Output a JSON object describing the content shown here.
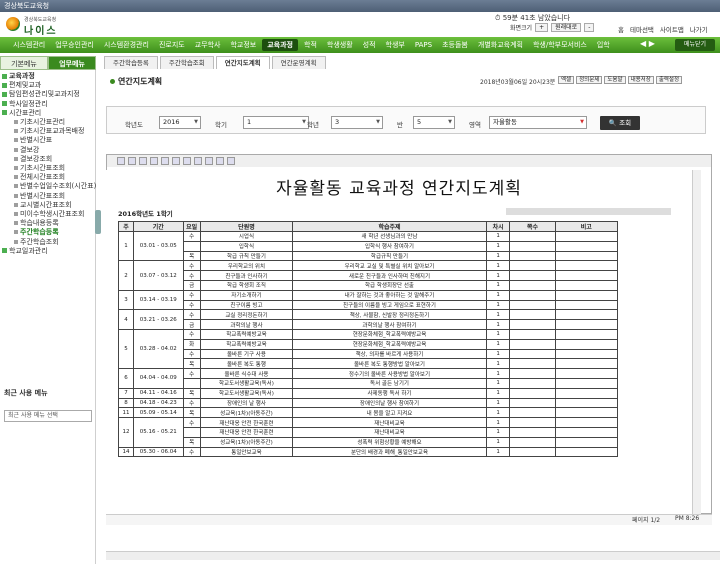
{
  "window": {
    "title": "경상북도교육청"
  },
  "logo": {
    "org": "경상북도교육청",
    "name": "나이스"
  },
  "session": {
    "text": "59분 41초 남았습니다",
    "zoom_label": "화면크기",
    "zoom_plus": "+",
    "zoom_value": "원래대로",
    "zoom_minus": "-"
  },
  "top_links": [
    "홈",
    "테마선택",
    "사이트맵",
    "나가기"
  ],
  "menu": [
    "시스템관리",
    "업무승인관리",
    "시스템환경관리",
    "진로지도",
    "교무학사",
    "학교정보",
    "교육과정",
    "학적",
    "학생생활",
    "성적",
    "학생부",
    "PAPS",
    "초등돌봄",
    "개별화교육계획",
    "학생/학부모서비스",
    "입학"
  ],
  "menu_active": 6,
  "close_all": "메뉴닫기",
  "left_tabs": [
    "기본메뉴",
    "업무메뉴"
  ],
  "tree": [
    {
      "label": "교육과정",
      "level": 0
    },
    {
      "label": "편제및교과",
      "level": 1
    },
    {
      "label": "탐임편성관리및교과지정",
      "level": 1
    },
    {
      "label": "학사일정관리",
      "level": 1
    },
    {
      "label": "시간표관리",
      "level": 1
    },
    {
      "label": "기초시간표관리",
      "level": 2
    },
    {
      "label": "기초시간표교과목배정",
      "level": 2
    },
    {
      "label": "반별시간표",
      "level": 2
    },
    {
      "label": "결보강",
      "level": 2
    },
    {
      "label": "결보강조회",
      "level": 2
    },
    {
      "label": "기초시간표조회",
      "level": 2
    },
    {
      "label": "전체시간표조회",
      "level": 2
    },
    {
      "label": "반별수업일수조회(시간표)",
      "level": 2
    },
    {
      "label": "반별시간표조회",
      "level": 2
    },
    {
      "label": "교시별시간표조회",
      "level": 2
    },
    {
      "label": "미이수학생시간표조회",
      "level": 2
    },
    {
      "label": "학습내용등록",
      "level": 2
    },
    {
      "label": "주간학습등록",
      "level": 2,
      "active": true
    },
    {
      "label": "주간학습조회",
      "level": 2
    },
    {
      "label": "학교일과관리",
      "level": 1
    }
  ],
  "recent": {
    "title": "최근 사용 메뉴",
    "placeholder": "최근 사용 메뉴 선택"
  },
  "page_tabs": [
    "주간학습등록",
    "주간학습조회",
    "연간지도계획",
    "연간운영계획"
  ],
  "page_tab_active": 2,
  "page": {
    "title": "연간지도계획",
    "datetime": "2018년03월06일 20시23분"
  },
  "actions": [
    "엑셀",
    "정의문제",
    "도움말",
    "내용저장",
    "출력설정"
  ],
  "filter": {
    "year_label": "학년도",
    "year": "2016",
    "term_label": "학기",
    "term": "1",
    "grade_label": "학년",
    "grade": "3",
    "class_label": "반",
    "class": "5",
    "area_label": "영역",
    "area": "자율활동",
    "search": "조회"
  },
  "report": {
    "title": "자율활동 교육과정 연간지도계획",
    "term_line": "2016학년도 1학기",
    "headers": [
      "주",
      "기간",
      "요일",
      "단원명",
      "학습주제",
      "차시",
      "쪽수",
      "비고"
    ],
    "rows": [
      {
        "w": "1",
        "p": "03.01 - 03.05",
        "rs": 3,
        "d": "수",
        "u": "시업식",
        "t": "새 학년 선생님과의 만남",
        "c": "1"
      },
      {
        "d": "",
        "u": "입학식",
        "t": "입학식 행사 참여하기",
        "c": "1"
      },
      {
        "d": "목",
        "u": "학급 규칙 만들기",
        "t": "학급규칙 만들기",
        "c": "1"
      },
      {
        "w": "2",
        "p": "03.07 - 03.12",
        "rs": 3,
        "d": "수",
        "u": "우리학교의 위치",
        "t": "우리학교 교실 및 특별실 위치 알아보기",
        "c": "1"
      },
      {
        "d": "수",
        "u": "친구들과 인사하기",
        "t": "새로운 친구들과 인사하며 친해지기",
        "c": "1"
      },
      {
        "d": "금",
        "u": "학급 학생회 조직",
        "t": "학급 학생회장단 선출",
        "c": "1"
      },
      {
        "w": "3",
        "p": "03.14 - 03.19",
        "rs": 2,
        "d": "수",
        "u": "자기소개하기",
        "t": "내가 잘하는 것과 좋아하는 것 말해주기",
        "c": "1"
      },
      {
        "d": "수",
        "u": "친구이름 빙고",
        "t": "친구들의 이름을 빙고 게임으로 표현하기",
        "c": "1"
      },
      {
        "w": "4",
        "p": "03.21 - 03.26",
        "rs": 2,
        "d": "수",
        "u": "교실 정리정돈하기",
        "t": "책상, 사물함, 신발장 정리정돈하기",
        "c": "1"
      },
      {
        "d": "금",
        "u": "과학의날 행사",
        "t": "과학의날 행사 참여하기",
        "c": "1"
      },
      {
        "w": "5",
        "p": "03.28 - 04.02",
        "rs": 4,
        "d": "수",
        "u": "학교폭력예방교육",
        "t": "현장문화체험_학교폭력예방교육",
        "c": "1"
      },
      {
        "d": "화",
        "u": "학교폭력예방교육",
        "t": "현장문화체험_학교폭력예방교육",
        "c": "1"
      },
      {
        "d": "수",
        "u": "올바른 기구 사용",
        "t": "책상, 의자를 바르게 사용하기",
        "c": "1"
      },
      {
        "d": "목",
        "u": "올바른 복도 통행",
        "t": "올바른 복도 통행방법 알아보기",
        "c": "1"
      },
      {
        "w": "6",
        "p": "04.04 - 04.09",
        "rs": 2,
        "d": "수",
        "u": "올바른 식수대 사용",
        "t": "정수기의 올바른 사용방법 알아보기",
        "c": "1"
      },
      {
        "d": "",
        "u": "학교도서생활교육(독서)",
        "t": "독서 골든 남기기",
        "c": "1"
      },
      {
        "w": "7",
        "p": "04.11 - 04.16",
        "rs": 1,
        "d": "목",
        "u": "학교도서생활교육(독서)",
        "t": "사제동행 독서 하기",
        "c": "1"
      },
      {
        "w": "8",
        "p": "04.18 - 04.23",
        "rs": 1,
        "d": "수",
        "u": "장애인의 날 행사",
        "t": "장애인의날 행사 참여하기",
        "c": "1"
      },
      {
        "w": "11",
        "p": "05.09 - 05.14",
        "rs": 1,
        "d": "목",
        "u": "성교육(1차)(아동주간)",
        "t": "내 몸을 알고 지켜요",
        "c": "1"
      },
      {
        "w": "12",
        "p": "05.16 - 05.21",
        "rs": 3,
        "d": "수",
        "u": "재난대응 안전 한국훈련",
        "t": "재난대비교육",
        "c": "1"
      },
      {
        "d": "",
        "u": "재난대응 안전 한국훈련",
        "t": "재난대비교육",
        "c": "1"
      },
      {
        "d": "목",
        "u": "성교육(1차)(아동주간)",
        "t": "성폭력 위험상황을 예방해요",
        "c": "1"
      },
      {
        "w": "14",
        "p": "05.30 - 06.04",
        "rs": 1,
        "d": "수",
        "u": "통일안보교육",
        "t": "분단의 배경과 폐해_통일안보교육",
        "c": "1"
      }
    ]
  },
  "viewer": {
    "page_info": "페이지 1/2",
    "zoom": "PM 8:26"
  }
}
